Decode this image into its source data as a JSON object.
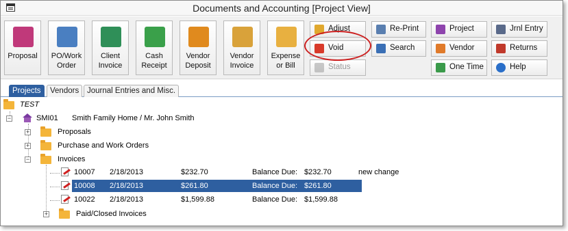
{
  "window": {
    "title": "Documents and Accounting [Project View]"
  },
  "toolbar": {
    "big_buttons": [
      {
        "label": "Proposal",
        "icon": "proposal-icon",
        "color": "#c0397a"
      },
      {
        "label": "PO/Work\nOrder",
        "icon": "po-work-order-icon",
        "color": "#4a7fc1"
      },
      {
        "label": "Client\nInvoice",
        "icon": "client-invoice-icon",
        "color": "#2f8f58"
      },
      {
        "label": "Cash\nReceipt",
        "icon": "cash-receipt-icon",
        "color": "#3aa04a"
      },
      {
        "label": "Vendor\nDeposit",
        "icon": "vendor-deposit-icon",
        "color": "#e08a1e"
      },
      {
        "label": "Vendor\nInvoice",
        "icon": "vendor-invoice-icon",
        "color": "#d9a23a"
      },
      {
        "label": "Expense\nor Bill",
        "icon": "expense-bill-icon",
        "color": "#e8b040"
      }
    ],
    "adjust": "Adjust",
    "void": "Void",
    "status": "Status",
    "reprint": "Re-Print",
    "search": "Search",
    "project": "Project",
    "vendor": "Vendor",
    "one_time": "One Time",
    "jrnl_entry": "Jrnl Entry",
    "returns": "Returns",
    "help": "Help"
  },
  "tabs": [
    {
      "label": "Projects",
      "active": true
    },
    {
      "label": "Vendors",
      "active": false
    },
    {
      "label": "Journal Entries and Misc.",
      "active": false
    }
  ],
  "tree": {
    "root": "TEST",
    "project_code": "SMI01",
    "project_name": "Smith Family Home / Mr. John Smith",
    "folders": {
      "proposals": "Proposals",
      "purchase": "Purchase and Work Orders",
      "invoices": "Invoices",
      "paid": "Paid/Closed Invoices"
    },
    "invoices": [
      {
        "number": "10007",
        "date": "2/18/2013",
        "amount": "$232.70",
        "balance_label": "Balance Due:",
        "balance": "$232.70",
        "note": "new change",
        "selected": false
      },
      {
        "number": "10008",
        "date": "2/18/2013",
        "amount": "$261.80",
        "balance_label": "Balance Due:",
        "balance": "$261.80",
        "note": "",
        "selected": true
      },
      {
        "number": "10022",
        "date": "2/18/2013",
        "amount": "$1,599.88",
        "balance_label": "Balance Due:",
        "balance": "$1,599.88",
        "note": "",
        "selected": false
      }
    ]
  },
  "colors": {
    "selection": "#2e5fa0",
    "highlight_ring": "#cc2020",
    "folder": "#f4b53a"
  }
}
